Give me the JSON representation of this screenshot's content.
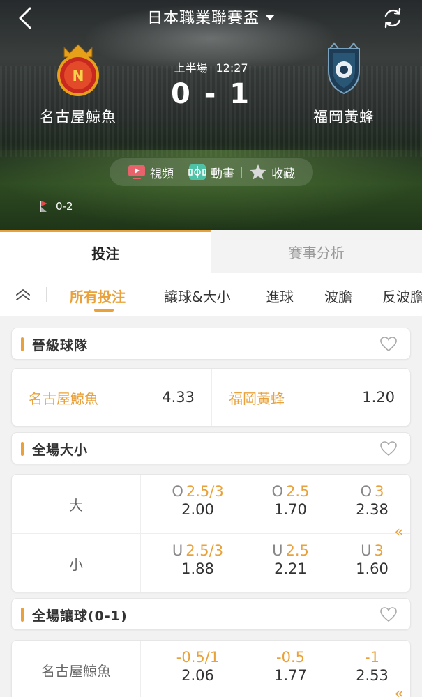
{
  "header": {
    "title": "日本職業聯賽盃"
  },
  "match": {
    "home": {
      "name": "名古屋鯨魚"
    },
    "away": {
      "name": "福岡黃蜂"
    },
    "period": "上半場",
    "time": "12:27",
    "score": "0 - 1",
    "actions": [
      {
        "label": "視頻",
        "icon": "video-icon"
      },
      {
        "label": "動畫",
        "icon": "animation-icon"
      },
      {
        "label": "收藏",
        "icon": "star-icon"
      }
    ],
    "corners": "0-2"
  },
  "main_tabs": [
    {
      "label": "投注",
      "active": true
    },
    {
      "label": "賽事分析",
      "active": false
    }
  ],
  "sub_tabs": [
    {
      "label": "所有投注",
      "active": true
    },
    {
      "label": "讓球&大小",
      "active": false
    },
    {
      "label": "進球",
      "active": false
    },
    {
      "label": "波膽",
      "active": false
    },
    {
      "label": "反波膽",
      "active": false
    }
  ],
  "sections": {
    "qualify": {
      "title": "晉級球隊",
      "options": [
        {
          "team": "名古屋鯨魚",
          "odds": "4.33"
        },
        {
          "team": "福岡黃蜂",
          "odds": "1.20"
        }
      ]
    },
    "total": {
      "title": "全場大小",
      "rows": [
        {
          "label": "大",
          "prefix": "O",
          "cells": [
            {
              "line": "2.5/3",
              "odds": "2.00"
            },
            {
              "line": "2.5",
              "odds": "1.70"
            },
            {
              "line": "3",
              "odds": "2.38"
            }
          ]
        },
        {
          "label": "小",
          "prefix": "U",
          "cells": [
            {
              "line": "2.5/3",
              "odds": "1.88"
            },
            {
              "line": "2.5",
              "odds": "2.21"
            },
            {
              "line": "3",
              "odds": "1.60"
            }
          ]
        }
      ]
    },
    "handicap": {
      "title": "全場讓球(0-1)",
      "rows": [
        {
          "label": "名古屋鯨魚",
          "cells": [
            {
              "line": "-0.5/1",
              "odds": "2.06"
            },
            {
              "line": "-0.5",
              "odds": "1.77"
            },
            {
              "line": "-1",
              "odds": "2.53"
            }
          ]
        }
      ]
    }
  },
  "colors": {
    "accent": "#e9a23b",
    "hero_dark": "#262a2c",
    "pitch_green": "#2d4a22",
    "background": "#f2f2f2"
  }
}
